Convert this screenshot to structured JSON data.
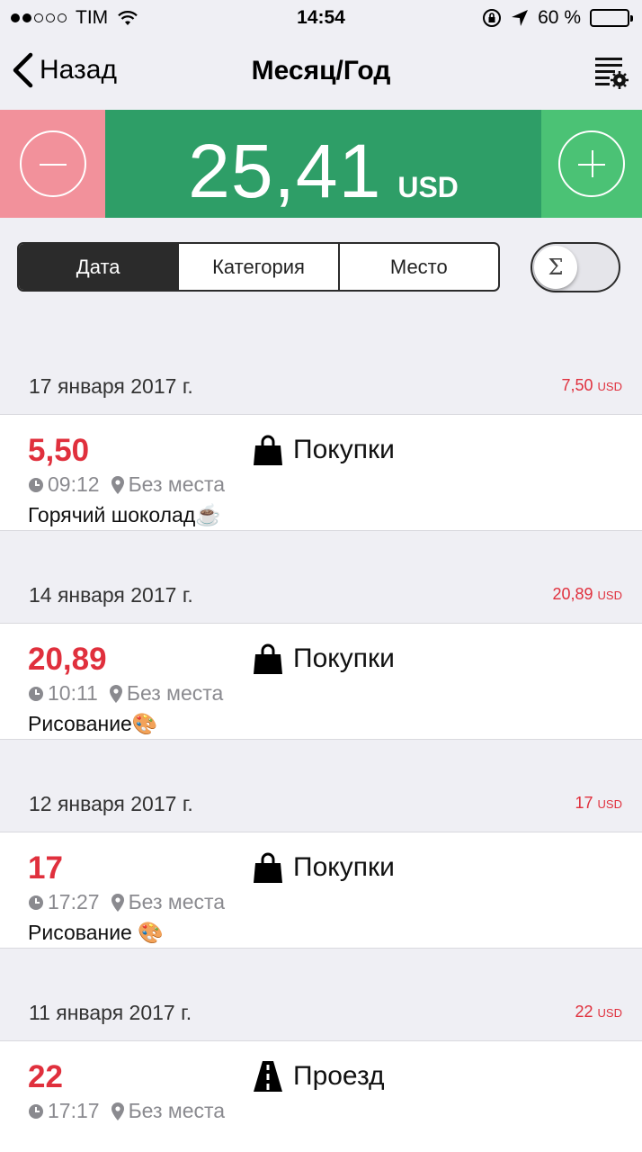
{
  "status_bar": {
    "carrier": "TIM",
    "time": "14:54",
    "battery": "60 %",
    "battery_level": 0.6
  },
  "nav": {
    "back_label": "Назад",
    "title": "Месяц/Год",
    "settings_icon": "list-settings-icon"
  },
  "amount": {
    "value": "25,41",
    "currency": "USD"
  },
  "colors": {
    "minus": "#f2919b",
    "balance": "#2e9e67",
    "plus": "#4bc275",
    "expense": "#e0303d"
  },
  "segments": [
    "Дата",
    "Категория",
    "Место"
  ],
  "toggle": {
    "symbol": "Σ"
  },
  "groups": [
    {
      "date": "17 января 2017 г.",
      "total": "7,50",
      "currency": "USD",
      "items": [
        {
          "amount": "5,50",
          "time": "09:12",
          "place": "Без места",
          "category": "Покупки",
          "category_icon": "shopping-bag-icon",
          "note": "Горячий шоколад☕"
        }
      ]
    },
    {
      "date": "14 января 2017 г.",
      "total": "20,89",
      "currency": "USD",
      "items": [
        {
          "amount": "20,89",
          "time": "10:11",
          "place": "Без места",
          "category": "Покупки",
          "category_icon": "shopping-bag-icon",
          "note": "Рисование🎨"
        }
      ]
    },
    {
      "date": "12 января 2017 г.",
      "total": "17",
      "currency": "USD",
      "items": [
        {
          "amount": "17",
          "time": "17:27",
          "place": "Без места",
          "category": "Покупки",
          "category_icon": "shopping-bag-icon",
          "note": "Рисование 🎨"
        }
      ]
    },
    {
      "date": "11 января 2017 г.",
      "total": "22",
      "currency": "USD",
      "items": [
        {
          "amount": "22",
          "time": "17:17",
          "place": "Без места",
          "category": "Проезд",
          "category_icon": "road-icon",
          "note": ""
        }
      ]
    }
  ]
}
